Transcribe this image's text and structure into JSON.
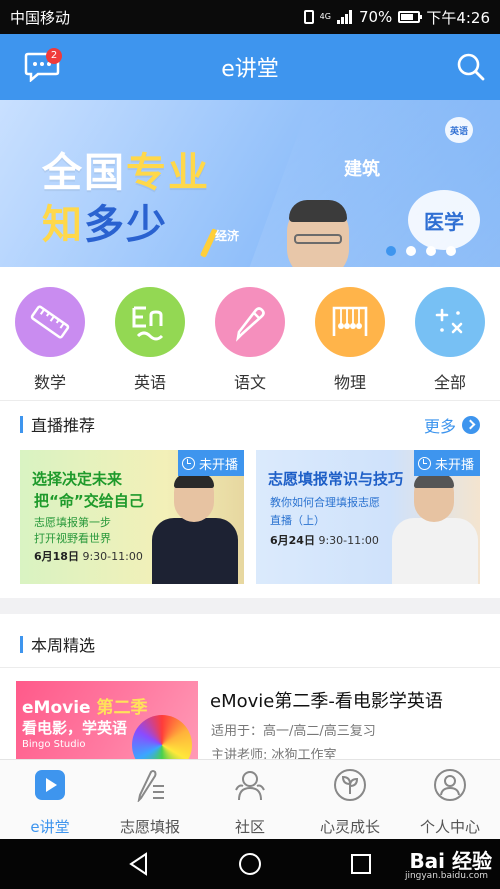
{
  "status_bar": {
    "carrier": "中国移动",
    "network": "4G",
    "battery": "70%",
    "battery_level": 0.7,
    "time": "下午4:26"
  },
  "header": {
    "title": "e讲堂",
    "message_badge": "2"
  },
  "banner": {
    "line1_a": "全国",
    "line1_b": "专业",
    "line2_a": "知",
    "line2_b": "多少",
    "bubbles": [
      "建筑",
      "医学",
      "经济",
      "英语"
    ],
    "slide_count": 4,
    "active_slide": 1
  },
  "categories": [
    {
      "label": "数学",
      "icon": "ruler-icon",
      "color": "#c98cf0"
    },
    {
      "label": "英语",
      "icon": "en-letters-icon",
      "color": "#93d853"
    },
    {
      "label": "语文",
      "icon": "pencil-icon",
      "color": "#f58fbd"
    },
    {
      "label": "物理",
      "icon": "newtons-cradle-icon",
      "color": "#ffb44a"
    },
    {
      "label": "全部",
      "icon": "plus-multiply-icon",
      "color": "#77c0f4"
    }
  ],
  "live": {
    "section_title": "直播推荐",
    "more_label": "更多",
    "cards": [
      {
        "title_line1": "选择决定未来",
        "title_line2": "把“命”交给自己",
        "sub_line1": "志愿填报第一步",
        "sub_line2": "打开视野看世界",
        "date": "6月18日",
        "time": "9:30-11:00",
        "status": "未开播"
      },
      {
        "title_line1": "志愿填报常识与技巧",
        "sub_line1": "教你如何合理填报志愿",
        "sub_line2": "直播（上）",
        "date": "6月24日",
        "time": "9:30-11:00",
        "status": "未开播"
      }
    ]
  },
  "weekly": {
    "section_title": "本周精选",
    "course": {
      "image_line1_a": "eMovie",
      "image_line1_b": "第二季",
      "image_line2": "看电影，学英语",
      "image_line3": "Bingo Studio",
      "title": "eMovie第二季-看电影学英语",
      "audience": "适用于：高一/高二/高三复习",
      "teacher": "主讲老师: 冰狗工作室"
    }
  },
  "tabbar": {
    "tabs": [
      {
        "label": "e讲堂",
        "icon": "play-icon",
        "active": true
      },
      {
        "label": "志愿填报",
        "icon": "pen-list-icon",
        "active": false
      },
      {
        "label": "社区",
        "icon": "community-icon",
        "active": false
      },
      {
        "label": "心灵成长",
        "icon": "sprout-icon",
        "active": false
      },
      {
        "label": "个人中心",
        "icon": "person-icon",
        "active": false
      }
    ]
  },
  "navbar": {
    "watermark": "Bai 经验",
    "watermark_sub": "jingyan.baidu.com"
  },
  "colors": {
    "primary": "#3e95ee",
    "badge": "#f03b3b"
  }
}
